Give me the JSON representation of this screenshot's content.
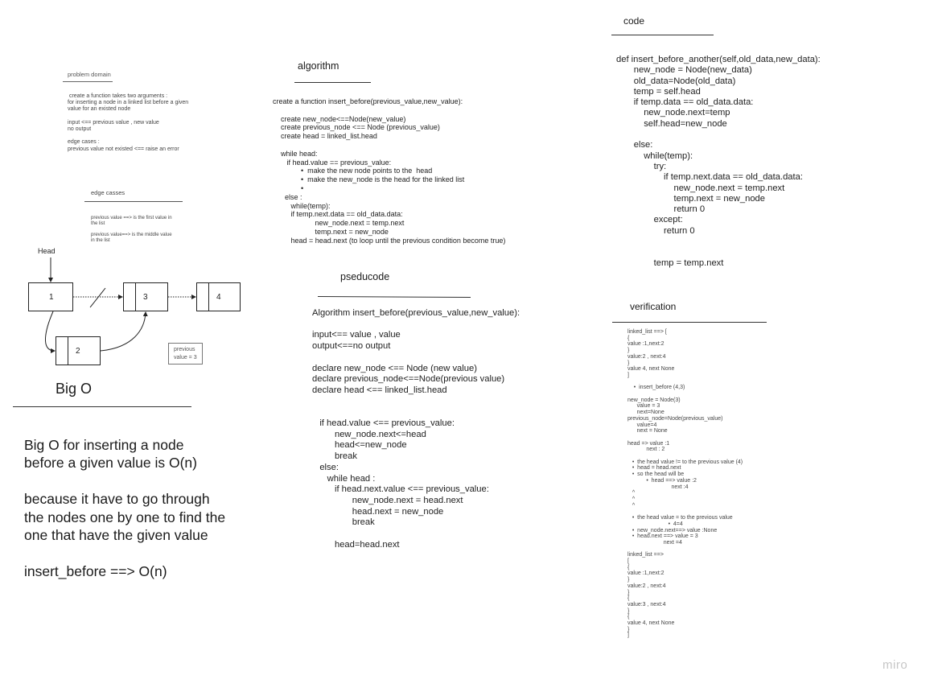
{
  "problem_domain": {
    "title": "problem domain",
    "lines": [
      " create a function takes two arguments :",
      "for inserting a node in a linked list before a given",
      "value for an existed node",
      "",
      "input <== previous value , new value",
      "no output",
      "",
      "edge cases :",
      "previous value not existed <== raise an error"
    ]
  },
  "edge_cases": {
    "title": "edge casses",
    "lines": [
      "previous value ==> is the first value in",
      "the list",
      "",
      "previous value==> is the middle value",
      "in the list"
    ]
  },
  "diagram": {
    "head_label": "Head",
    "nodes": [
      {
        "value": "1"
      },
      {
        "value": "3"
      },
      {
        "value": "4"
      },
      {
        "value": "2"
      }
    ],
    "note_lines": [
      "previous",
      "value = 3"
    ]
  },
  "big_o": {
    "title": "Big O",
    "lines": [
      "Big O for inserting a node",
      "before a given value is O(n)",
      "",
      "because it have to go through",
      "the nodes one by one to find the",
      "one that have the given value",
      "",
      "insert_before ==> O(n)"
    ]
  },
  "algorithm": {
    "title": "algorithm",
    "lines": [
      "create a function insert_before(previous_value,new_value):",
      "",
      "    create new_node<==Node(new_value)",
      "    create previous_node <== Node (previous_value)",
      "    create head = linked_list.head",
      "",
      "    while head:",
      "       if head.value == previous_value:",
      "              •  make the new node points to the  head",
      "              •  make the new_node is the head for the linked list",
      "              •",
      "      else :",
      "         while(temp):",
      "         if temp.next.data == old_data.data:",
      "                     new_node.next = temp.next",
      "                     temp.next = new_node",
      "         head = head.next (to loop until the previous condition become true)"
    ]
  },
  "pseudocode": {
    "title": "pseducode",
    "lines": [
      "Algorithm insert_before(previous_value,new_value):",
      "",
      "input<== value , value",
      "output<==no output",
      "",
      "declare new_node <== Node (new value)",
      "declare previous_node<==Node(previous value)",
      "declare head <== linked_list.head",
      "",
      "",
      "   if head.value <== previous_value:",
      "         new_node.next<=head",
      "         head<=new_node",
      "         break",
      "   else:",
      "      while head :",
      "         if head.next.value <== previous_value:",
      "                new_node.next = head.next",
      "                head.next = new_node",
      "                break",
      "",
      "         head=head.next"
    ]
  },
  "code": {
    "title": "code",
    "lines": [
      "def insert_before_another(self,old_data,new_data):",
      "       new_node = Node(new_data)",
      "       old_data=Node(old_data)",
      "       temp = self.head",
      "       if temp.data == old_data.data:",
      "           new_node.next=temp",
      "           self.head=new_node",
      "",
      "       else:",
      "           while(temp):",
      "               try:",
      "                   if temp.next.data == old_data.data:",
      "                       new_node.next = temp.next",
      "                       temp.next = new_node",
      "                       return 0",
      "               except:",
      "                   return 0",
      "",
      "",
      "               temp = temp.next"
    ]
  },
  "verification": {
    "title": "verification",
    "lines": [
      "linked_list ==> [",
      "{",
      "value :1,next:2",
      "}",
      "value:2 , next:4",
      "}",
      "value 4, next None",
      "]",
      "",
      "    •  insert_before (4,3)",
      "",
      "new_node = Node(3)",
      "      value = 3",
      "      next=None",
      "previous_node=Node(previous_value)",
      "      value=4",
      "      next = None",
      "",
      "head => value :1",
      "            next : 2",
      "",
      "   •  the head value != to the previous value (4)",
      "   •  head = head.next",
      "   •  so the head will be",
      "            •  head ==> value :2",
      "                            next :4",
      "   ^",
      "   ^",
      "   ^",
      "",
      "   •  the head value = to the previous value",
      "                          •  4=4",
      "   •  new_node.next==> value :None",
      "   •  head.next ==> value = 3",
      "                       next =4",
      "",
      "linked_list ==>",
      "[",
      "{",
      "value :1,next:2",
      "}",
      "value:2 , next:4",
      "}",
      "{",
      "value:3 , next:4",
      "}",
      "{",
      "value 4, next None",
      "}",
      "]"
    ]
  },
  "watermark": "miro"
}
